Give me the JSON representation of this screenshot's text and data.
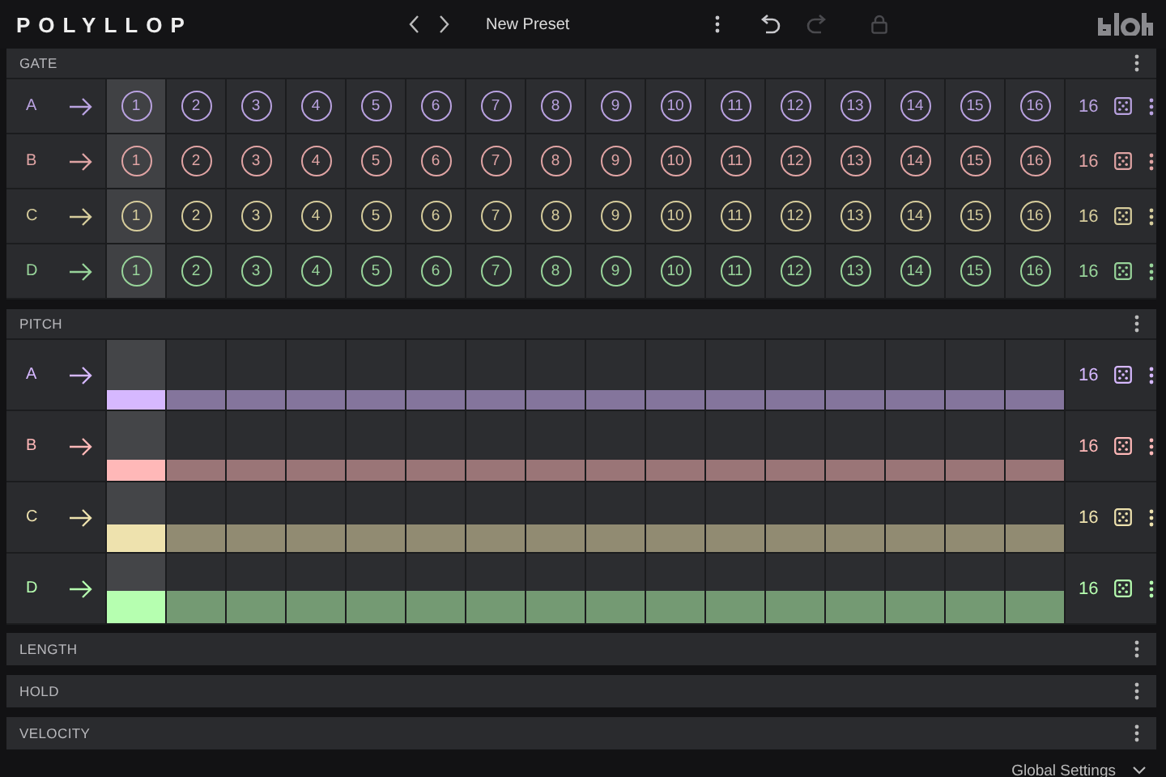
{
  "header": {
    "logo": "POLYLLOP",
    "preset": "New Preset",
    "tools": [
      {
        "kind": "menu",
        "disabled": false
      },
      {
        "kind": "undo",
        "disabled": false
      },
      {
        "kind": "redo",
        "disabled": true
      },
      {
        "kind": "lock",
        "disabled": true
      }
    ]
  },
  "playhead": [
    true,
    false,
    false,
    false,
    false,
    false,
    false,
    false,
    false,
    false,
    false,
    false,
    false,
    false,
    false,
    false
  ],
  "gate": {
    "title": "GATE",
    "rows": [
      {
        "name": "A",
        "color": "#b9a2e0",
        "length": "16",
        "steps": [
          "1",
          "2",
          "3",
          "4",
          "5",
          "6",
          "7",
          "8",
          "9",
          "10",
          "11",
          "12",
          "13",
          "14",
          "15",
          "16"
        ]
      },
      {
        "name": "B",
        "color": "#e0a4a4",
        "length": "16",
        "steps": [
          "1",
          "2",
          "3",
          "4",
          "5",
          "6",
          "7",
          "8",
          "9",
          "10",
          "11",
          "12",
          "13",
          "14",
          "15",
          "16"
        ]
      },
      {
        "name": "C",
        "color": "#d6cc9c",
        "length": "16",
        "steps": [
          "1",
          "2",
          "3",
          "4",
          "5",
          "6",
          "7",
          "8",
          "9",
          "10",
          "11",
          "12",
          "13",
          "14",
          "15",
          "16"
        ]
      },
      {
        "name": "D",
        "color": "#98d49a",
        "length": "16",
        "steps": [
          "1",
          "2",
          "3",
          "4",
          "5",
          "6",
          "7",
          "8",
          "9",
          "10",
          "11",
          "12",
          "13",
          "14",
          "15",
          "16"
        ]
      }
    ]
  },
  "pitch": {
    "title": "PITCH",
    "rows": [
      {
        "name": "A",
        "color": "#d6b8ff",
        "length": "16",
        "level": 0.28
      },
      {
        "name": "B",
        "color": "#ffb8b8",
        "length": "16",
        "level": 0.3
      },
      {
        "name": "C",
        "color": "#eee2ae",
        "length": "16",
        "level": 0.4
      },
      {
        "name": "D",
        "color": "#b6ffb0",
        "length": "16",
        "level": 0.47
      }
    ]
  },
  "sections": [
    {
      "title": "LENGTH"
    },
    {
      "title": "HOLD"
    },
    {
      "title": "VELOCITY"
    }
  ],
  "footer": {
    "label": "Global Settings"
  }
}
